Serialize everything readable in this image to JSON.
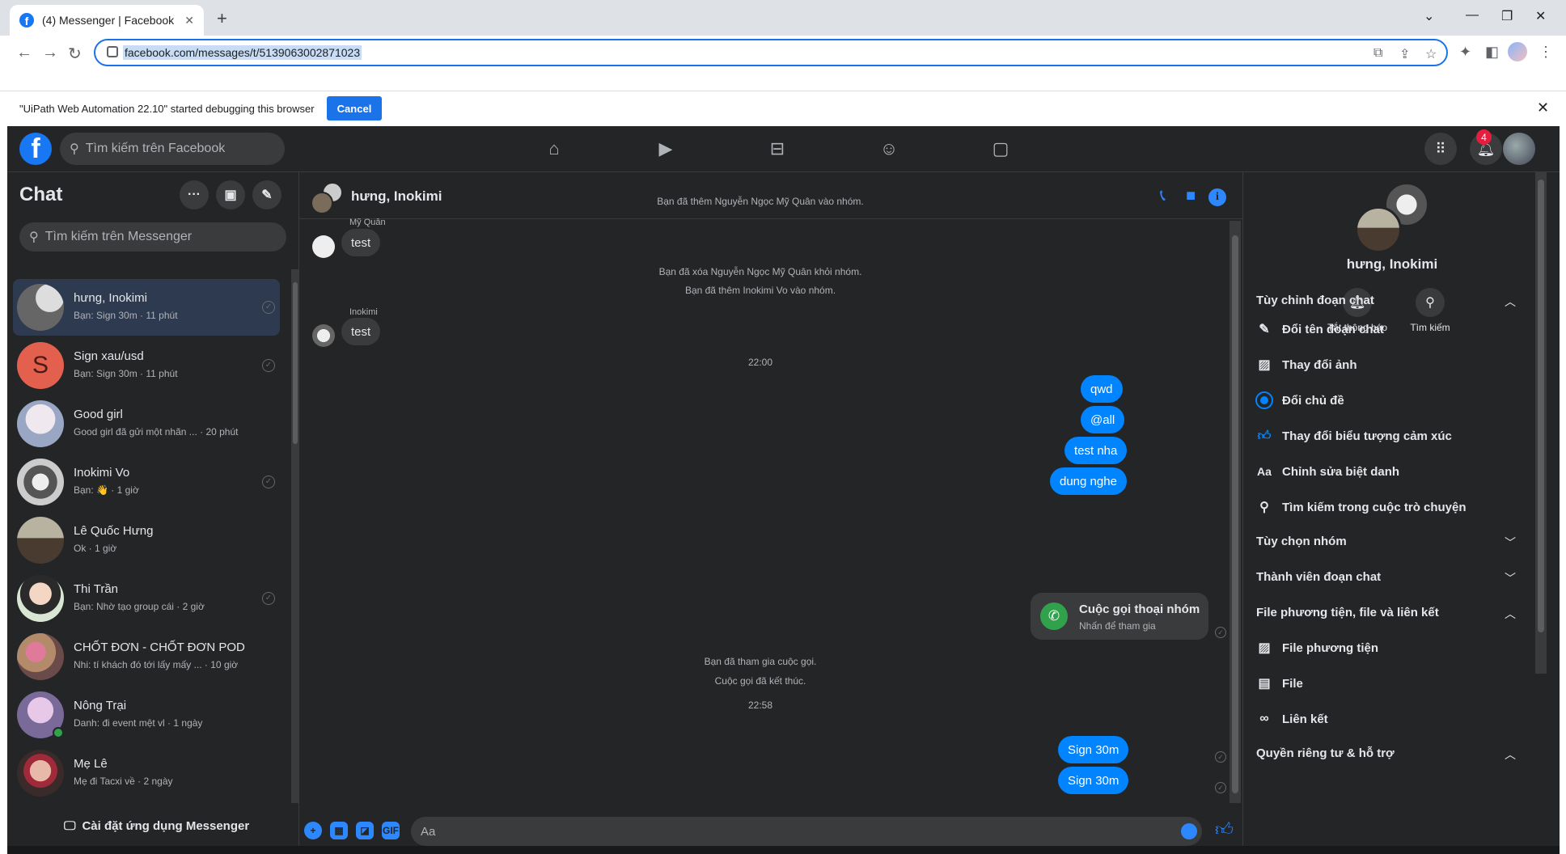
{
  "browser": {
    "tab_title": "(4) Messenger | Facebook",
    "url": "facebook.com/messages/t/5139063002871023",
    "debug_message": "\"UiPath Web Automation 22.10\" started debugging this browser",
    "debug_cancel": "Cancel"
  },
  "fbnav": {
    "search_placeholder": "Tìm kiếm trên Facebook",
    "notif_count": "4"
  },
  "left": {
    "title": "Chat",
    "search_placeholder": "Tìm kiếm trên Messenger",
    "install": "Cài đặt ứng dụng Messenger",
    "conversations": [
      {
        "name": "hưng, Inokimi",
        "preview": "Bạn: Sign 30m · 11 phút"
      },
      {
        "name": "Sign xau/usd",
        "preview": "Bạn: Sign 30m · 11 phút",
        "initial": "S"
      },
      {
        "name": "Good girl",
        "preview": "Good girl đã gửi một nhãn ... · 20 phút"
      },
      {
        "name": "Inokimi Vo",
        "preview": "Bạn: 👋 · 1 giờ"
      },
      {
        "name": "Lê Quốc Hưng",
        "preview": "Ok · 1 giờ"
      },
      {
        "name": "Thi Trần",
        "preview": "Bạn: Nhờ tạo group cái · 2 giờ"
      },
      {
        "name": "CHỐT ĐƠN - CHỐT ĐƠN POD",
        "preview": "Nhi: tí khách đó tới lấy mấy ... · 10 giờ"
      },
      {
        "name": "Nông Trại",
        "preview": "Danh: đi event mệt vl · 1 ngày"
      },
      {
        "name": "Mẹ Lê",
        "preview": "Mẹ đi Tacxi về · 2 ngày"
      }
    ]
  },
  "chat": {
    "name": "hưng, Inokimi",
    "sys1": "Bạn đã thêm Nguyễn Ngọc Mỹ Quân vào nhóm.",
    "sender1": "Mỹ Quân",
    "msg1": "test",
    "sys2": "Bạn đã xóa Nguyễn Ngọc Mỹ Quân khỏi nhóm.",
    "sys3": "Bạn đã thêm Inokimi Vo vào nhóm.",
    "sender2": "Inokimi",
    "msg2": "test",
    "time1": "22:00",
    "out1": "qwd",
    "out2": "@all",
    "out3": "test nha",
    "out4": "dung nghe",
    "call_title": "Cuộc gọi thoại nhóm",
    "call_sub": "Nhấn để tham gia",
    "sys4": "Bạn đã tham gia cuộc gọi.",
    "sys5": "Cuộc gọi đã kết thúc.",
    "time2": "22:58",
    "out5": "Sign 30m",
    "out6": "Sign 30m",
    "composer_placeholder": "Aa"
  },
  "right": {
    "name": "hưng, Inokimi",
    "action_mute": "Tắt thông báo",
    "action_search": "Tìm kiếm",
    "sec_customize": "Tùy chỉnh đoạn chat",
    "rename": "Đổi tên đoạn chat",
    "change_photo": "Thay đổi ảnh",
    "change_theme": "Đổi chủ đề",
    "change_emoji": "Thay đổi biểu tượng cảm xúc",
    "nicknames": "Chỉnh sửa biệt danh",
    "search_conv": "Tìm kiếm trong cuộc trò chuyện",
    "sec_group": "Tùy chọn nhóm",
    "sec_members": "Thành viên đoạn chat",
    "sec_media": "File phương tiện, file và liên kết",
    "media": "File phương tiện",
    "files": "File",
    "links": "Liên kết",
    "sec_privacy": "Quyền riêng tư & hỗ trợ"
  }
}
